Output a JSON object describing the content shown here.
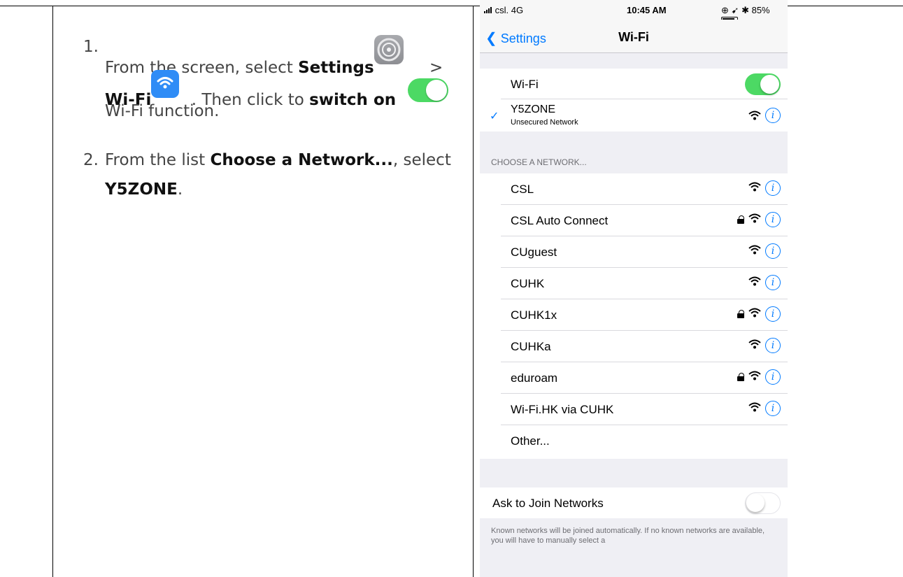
{
  "instructions": {
    "step1": {
      "number": "1.",
      "text_a": "From the screen, select ",
      "settings": "Settings",
      "arrow": ">",
      "wifi": "Wi-Fi",
      "text_b": ". Then click to ",
      "switch_on": "switch on",
      "text_c": "Wi-Fi function."
    },
    "step2": {
      "number": "2.",
      "text_a": "From the list ",
      "choose": "Choose a Network...",
      "text_b": ", select",
      "y5zone": "Y5ZONE",
      "period": "."
    }
  },
  "phone": {
    "status": {
      "carrier": "csl.",
      "network": "4G",
      "time": "10:45 AM",
      "battery": "85%"
    },
    "nav": {
      "back_label": "Settings",
      "title": "Wi-Fi"
    },
    "wifi_row": {
      "label": "Wi-Fi",
      "on": true
    },
    "connected": {
      "name": "Y5ZONE",
      "subtitle": "Unsecured Network"
    },
    "section_header": "CHOOSE A NETWORK...",
    "networks": [
      {
        "name": "CSL",
        "locked": false
      },
      {
        "name": "CSL Auto Connect",
        "locked": true
      },
      {
        "name": "CUguest",
        "locked": false
      },
      {
        "name": "CUHK",
        "locked": false
      },
      {
        "name": "CUHK1x",
        "locked": true
      },
      {
        "name": "CUHKa",
        "locked": false
      },
      {
        "name": "eduroam",
        "locked": true
      },
      {
        "name": "Wi-Fi.HK via CUHK",
        "locked": false
      },
      {
        "name": "Other...",
        "other": true
      }
    ],
    "ask_to_join": {
      "label": "Ask to Join Networks",
      "on": false
    },
    "footer_note": "Known networks will be joined automatically. If no known networks are available, you will have to manually select a"
  },
  "colors": {
    "accent": "#007aff",
    "toggle_on": "#4cd964",
    "group_bg": "#efeff4"
  }
}
